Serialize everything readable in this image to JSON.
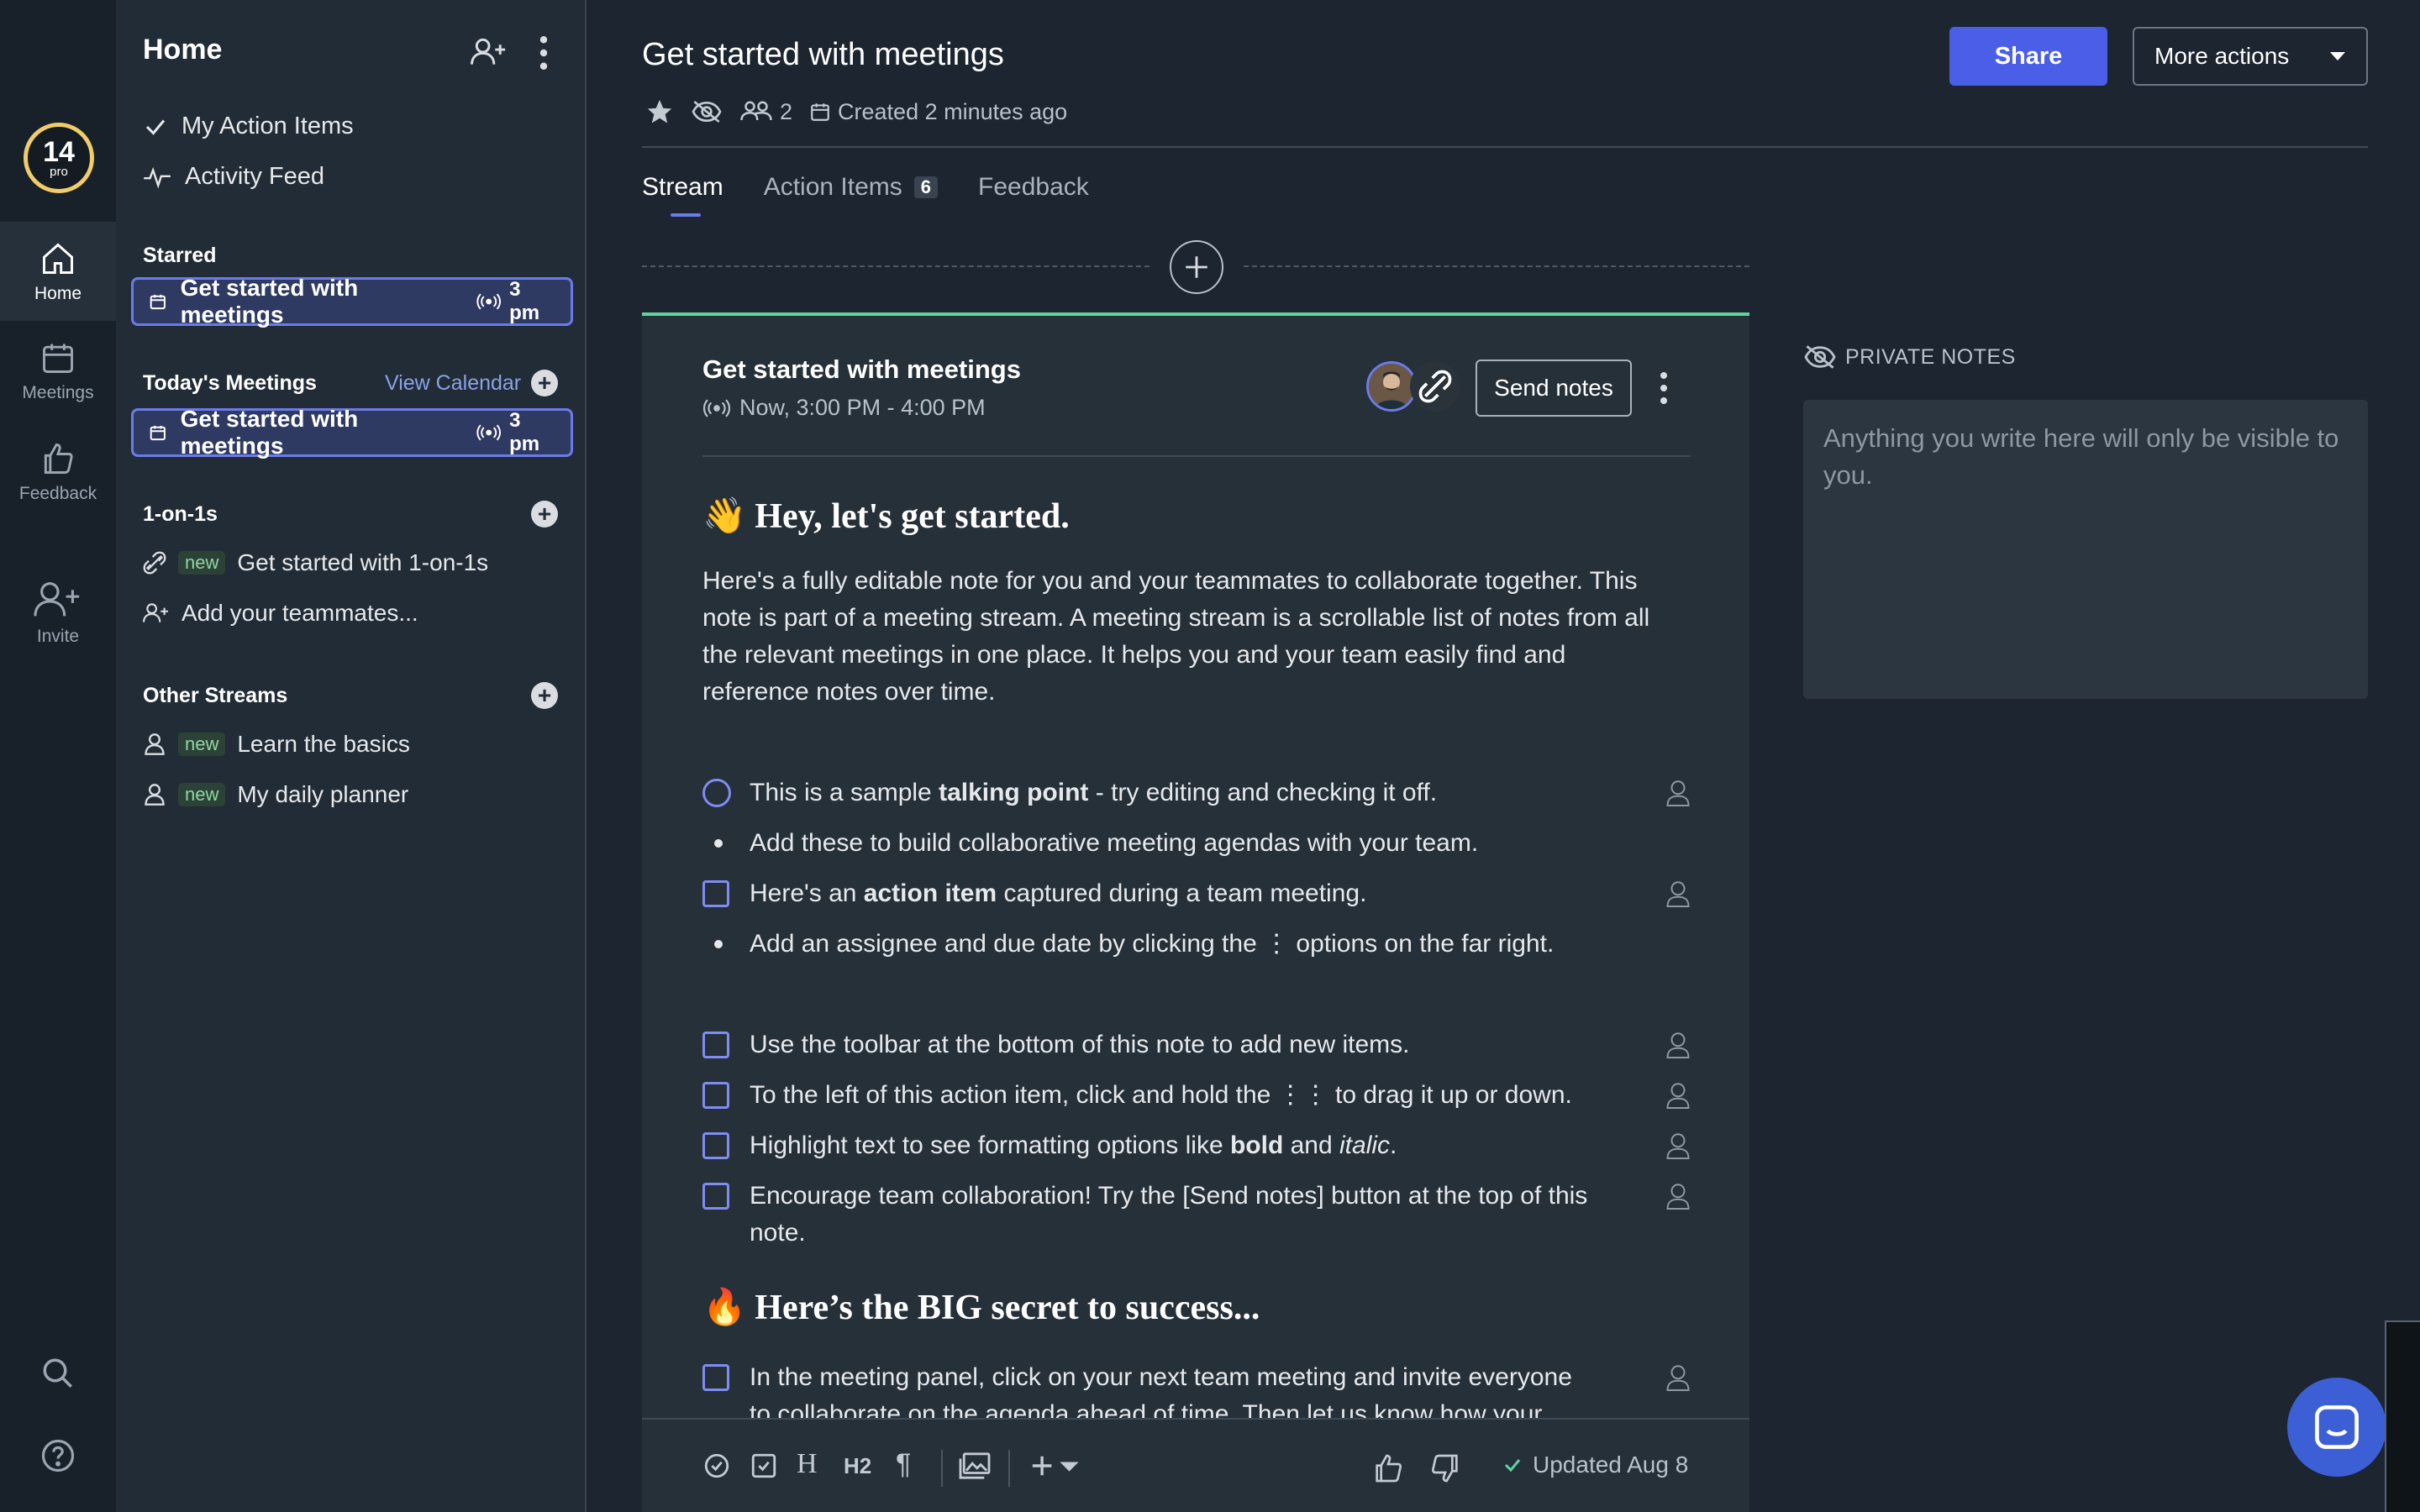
{
  "rail": {
    "badge_number": "14",
    "badge_sub": "pro",
    "items": [
      {
        "label": "Home"
      },
      {
        "label": "Meetings"
      },
      {
        "label": "Feedback"
      },
      {
        "label": "Invite"
      }
    ]
  },
  "sidebar": {
    "title": "Home",
    "links": [
      {
        "label": "My Action Items",
        "icon": "check-icon"
      },
      {
        "label": "Activity Feed",
        "icon": "pulse-icon"
      }
    ],
    "starred": {
      "heading": "Starred",
      "items": [
        {
          "label": "Get started with meetings",
          "time": "3 pm"
        }
      ]
    },
    "today": {
      "heading": "Today's Meetings",
      "view_calendar": "View Calendar",
      "items": [
        {
          "label": "Get started with meetings",
          "time": "3 pm"
        }
      ]
    },
    "one_on_ones": {
      "heading": "1-on-1s",
      "items": [
        {
          "tag": "new",
          "label": "Get started with 1-on-1s"
        },
        {
          "tag": "",
          "label": "Add your teammates..."
        }
      ]
    },
    "other_streams": {
      "heading": "Other Streams",
      "items": [
        {
          "tag": "new",
          "label": "Learn the basics"
        },
        {
          "tag": "new",
          "label": "My daily planner"
        }
      ]
    }
  },
  "header": {
    "title": "Get started with meetings",
    "attendees": "2",
    "created": "Created 2 minutes ago",
    "share": "Share",
    "more_actions": "More actions"
  },
  "tabs": [
    {
      "label": "Stream",
      "count": ""
    },
    {
      "label": "Action Items",
      "count": "6"
    },
    {
      "label": "Feedback",
      "count": ""
    }
  ],
  "note": {
    "title": "Get started with meetings",
    "time": "Now, 3:00 PM - 4:00 PM",
    "send_notes": "Send notes",
    "heading1": "Hey, let's get started.",
    "heading1_emoji": "👋",
    "paragraph": "Here's a fully editable note for you and your teammates to collaborate together. This note is part of a meeting stream. A meeting stream is a scrollable list of notes from all the relevant meetings in one place. It helps you and your team easily find and reference notes over time.",
    "items": [
      {
        "type": "talking-point",
        "before": "This is a sample ",
        "bold": "talking point",
        "after": " - try editing and checking it off."
      },
      {
        "type": "bullet",
        "text": "Add these to build collaborative meeting agendas with your team."
      },
      {
        "type": "action",
        "before": "Here's an ",
        "bold": "action item",
        "after": " captured during a team meeting."
      },
      {
        "type": "bullet",
        "text": "Add an assignee and due date by clicking the ⋮ options on the far right."
      },
      {
        "type": "action",
        "text": "Use the toolbar at the bottom of this note to add new items."
      },
      {
        "type": "action",
        "text": "To the left of this action item, click and hold the ⋮⋮ to drag it up or down."
      },
      {
        "type": "action",
        "before": "Highlight text to see formatting options like ",
        "bold": "bold",
        "middle": " and ",
        "italic": "italic",
        "after": "."
      },
      {
        "type": "action",
        "text": "Encourage team collaboration! Try the [Send notes] button at the top of this note."
      }
    ],
    "heading2": "Here’s the BIG secret to success...",
    "heading2_emoji": "🔥",
    "last_item": "In the meeting panel, click on your next team meeting and invite everyone to collaborate on the agenda ahead of time. Then let us know how your",
    "updated": "Updated Aug 8"
  },
  "private_notes": {
    "label": "PRIVATE NOTES",
    "placeholder": "Anything you write here will only be visible to you."
  },
  "colors": {
    "accent": "#4a5ee8",
    "note_border": "#5fd4a0",
    "badge_ring": "#f0cc6a"
  }
}
